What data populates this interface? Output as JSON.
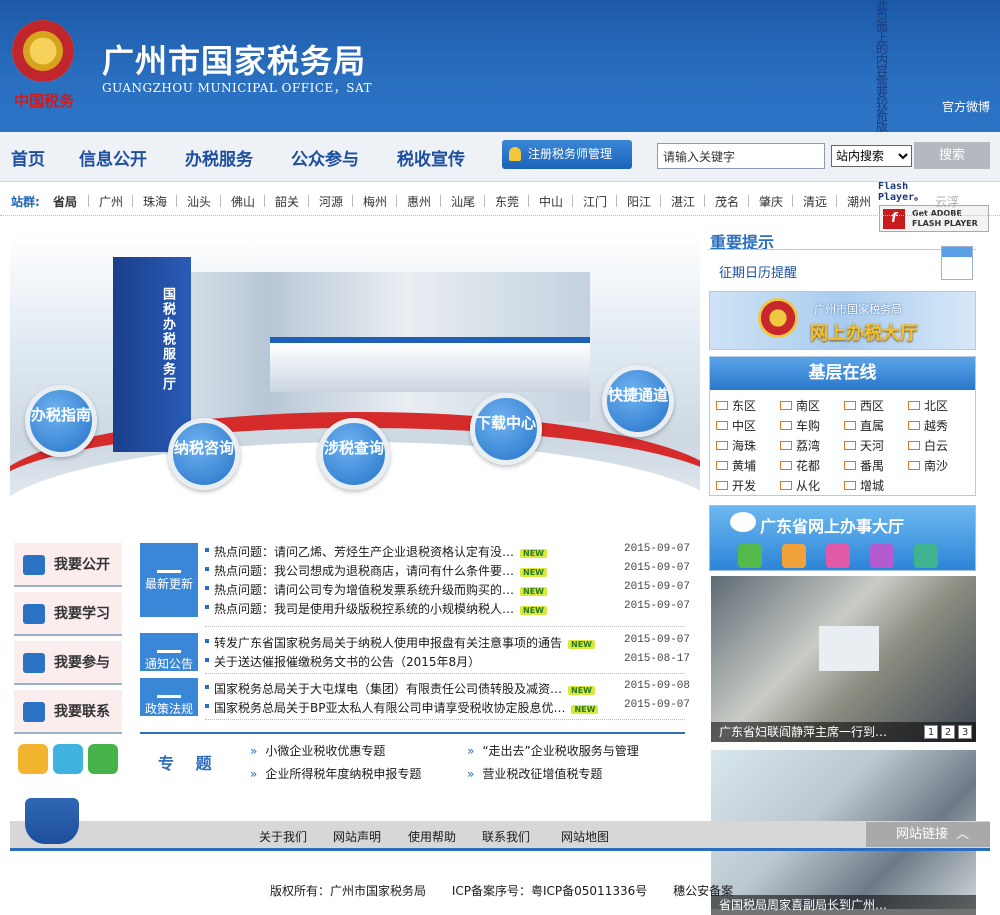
{
  "header": {
    "emblem_text": "中国税务",
    "title": "广州市国家税务局",
    "subtitle": "GUANGZHOU MUNICIPAL OFFICE，SAT",
    "weibo_link": "官方微博",
    "flash_notice_vertical": "此页面上的内容需要较新版本的",
    "flash_notice_brand": "Adobe Flash Player。",
    "flash_badge": "Get ADOBE FLASH PLAYER"
  },
  "nav": {
    "items": [
      "首页",
      "信息公开",
      "办税服务",
      "公众参与",
      "税收宣传"
    ],
    "cpa_button": "注册税务师管理",
    "search_value": "请输入关键字",
    "search_scope": "站内搜索",
    "search_button": "搜索"
  },
  "stations": {
    "label": "站群:",
    "items": [
      "省局",
      "广州",
      "珠海",
      "汕头",
      "佛山",
      "韶关",
      "河源",
      "梅州",
      "惠州",
      "汕尾",
      "东莞",
      "中山",
      "江门",
      "阳江",
      "湛江",
      "茂名",
      "肇庆",
      "清远",
      "潮州",
      "云浮"
    ]
  },
  "banner": {
    "pillar_text": "国税办税服务厅",
    "bubbles": [
      "办税指南",
      "纳税咨询",
      "涉税查询",
      "下载中心",
      "快捷通道"
    ]
  },
  "notice": {
    "title": "重要提示",
    "calendar_link": "征期日历提醒",
    "hall_small": "广州市国家税务局",
    "hall_big": "网上办税大厅"
  },
  "grassroots": {
    "title": "基层在线",
    "districts": [
      "东区",
      "南区",
      "西区",
      "北区",
      "中区",
      "车购",
      "直属",
      "越秀",
      "海珠",
      "荔湾",
      "天河",
      "白云",
      "黄埔",
      "花都",
      "番禺",
      "南沙",
      "开发",
      "从化",
      "增城"
    ]
  },
  "gd_hall": "广东省网上办事大厅",
  "photos": {
    "caption1": "广东省妇联阎静萍主席一行到…",
    "pages": [
      "1",
      "2",
      "3"
    ],
    "caption2": "省国税局周家喜副局长到广州…"
  },
  "side_menu": [
    "我要公开",
    "我要学习",
    "我要参与",
    "我要联系"
  ],
  "news": {
    "new_badge": "NEW",
    "groups": [
      {
        "tag": "最新更新",
        "items": [
          {
            "title": "热点问题：请问乙烯、芳烃生产企业退税资格认定有没…",
            "date": "2015-09-07"
          },
          {
            "title": "热点问题：我公司想成为退税商店，请问有什么条件要…",
            "date": "2015-09-07"
          },
          {
            "title": "热点问题：请问公司专为增值税发票系统升级而购买的…",
            "date": "2015-09-07"
          },
          {
            "title": "热点问题：我司是使用升级版税控系统的小规模纳税人…",
            "date": "2015-09-07"
          }
        ]
      },
      {
        "tag": "通知公告",
        "items": [
          {
            "title": "转发广东省国家税务局关于纳税人使用申报盘有关注意事项的通告",
            "date": "2015-09-07"
          },
          {
            "title": "关于送达催报催缴税务文书的公告（2015年8月）",
            "date": "2015-08-17"
          }
        ]
      },
      {
        "tag": "政策法规",
        "items": [
          {
            "title": "国家税务总局关于大屯煤电（集团）有限责任公司债转股及减资…",
            "date": "2015-09-08"
          },
          {
            "title": "国家税务总局关于BP亚太私人有限公司申请享受税收协定股息优…",
            "date": "2015-09-07"
          }
        ]
      }
    ]
  },
  "topics": {
    "label": "专 题",
    "items": [
      "小微企业税收优惠专题",
      "“走出去”企业税收服务与管理",
      "企业所得税年度纳税申报专题",
      "营业税改征增值税专题"
    ]
  },
  "footer": {
    "links": [
      "关于我们",
      "网站声明",
      "使用帮助",
      "联系我们",
      "网站地图"
    ],
    "site_links_tab": "网站链接",
    "copyright": "版权所有：广州市国家税务局",
    "icp": "ICP备案序号：粤ICP备05011336号",
    "police": "穗公安备案"
  },
  "colors": {
    "brand_blue": "#2a6fc0",
    "accent_red": "#d62b2b",
    "new_badge": "#d9e83a"
  }
}
